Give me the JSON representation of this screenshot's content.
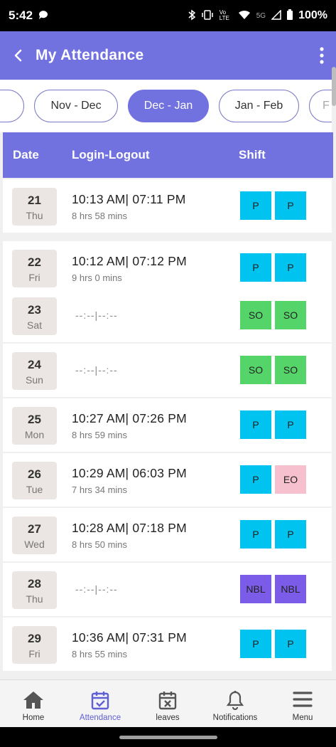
{
  "status_bar": {
    "time": "5:42",
    "battery": "100%",
    "network": "5G",
    "volte": "Vo LTE"
  },
  "header": {
    "title": "My Attendance"
  },
  "period_tabs": [
    {
      "label": ""
    },
    {
      "label": "Nov - Dec"
    },
    {
      "label": "Dec - Jan",
      "selected": true
    },
    {
      "label": "Jan - Feb"
    },
    {
      "label": "F"
    }
  ],
  "table": {
    "columns": [
      "Date",
      "Login-Logout",
      "Shift"
    ],
    "rows": [
      {
        "date": "21",
        "day": "Thu",
        "time": "10:13 AM| 07:11 PM",
        "duration": "8 hrs 58 mins",
        "shifts": [
          "P",
          "P"
        ]
      },
      {
        "date": "22",
        "day": "Fri",
        "time": "10:12 AM| 07:12 PM",
        "duration": "9 hrs 0 mins",
        "shifts": [
          "P",
          "P"
        ]
      },
      {
        "date": "23",
        "day": "Sat",
        "time": "--:--|--:--",
        "duration": "",
        "shifts": [
          "SO",
          "SO"
        ]
      },
      {
        "date": "24",
        "day": "Sun",
        "time": "--:--|--:--",
        "duration": "",
        "shifts": [
          "SO",
          "SO"
        ]
      },
      {
        "date": "25",
        "day": "Mon",
        "time": "10:27 AM| 07:26 PM",
        "duration": "8 hrs 59 mins",
        "shifts": [
          "P",
          "P"
        ]
      },
      {
        "date": "26",
        "day": "Tue",
        "time": "10:29 AM| 06:03 PM",
        "duration": "7 hrs 34 mins",
        "shifts": [
          "P",
          "EO"
        ]
      },
      {
        "date": "27",
        "day": "Wed",
        "time": "10:28 AM| 07:18 PM",
        "duration": "8 hrs 50 mins",
        "shifts": [
          "P",
          "P"
        ]
      },
      {
        "date": "28",
        "day": "Thu",
        "time": "--:--|--:--",
        "duration": "",
        "shifts": [
          "NBL",
          "NBL"
        ]
      },
      {
        "date": "29",
        "day": "Fri",
        "time": "10:36 AM| 07:31 PM",
        "duration": "8 hrs 55 mins",
        "shifts": [
          "P",
          "P"
        ]
      }
    ]
  },
  "shift_colors": {
    "P": "#00c3f0",
    "SO": "#55d46a",
    "EO": "#f7c0cf",
    "NBL": "#7b5ce8"
  },
  "bottom_nav": [
    {
      "label": "Home",
      "icon": "home-icon"
    },
    {
      "label": "Attendance",
      "icon": "calendar-check-icon",
      "active": true
    },
    {
      "label": "leaves",
      "icon": "calendar-x-icon"
    },
    {
      "label": "Notifications",
      "icon": "bell-icon"
    },
    {
      "label": "Menu",
      "icon": "menu-icon"
    }
  ],
  "colors": {
    "primary": "#7171e0",
    "active_nav": "#5f5fd6"
  }
}
